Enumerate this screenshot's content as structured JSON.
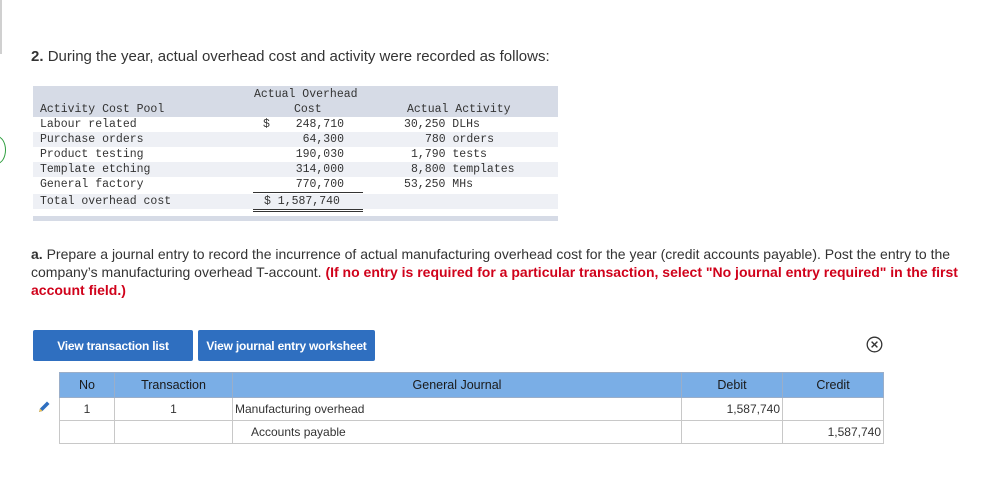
{
  "question": {
    "number": "2.",
    "text": "During the year, actual overhead cost and activity were recorded as follows:"
  },
  "overhead_table": {
    "header_pool": "Activity Cost Pool",
    "header_cost_line1": "Actual Overhead",
    "header_cost_line2": "Cost",
    "header_activity": "Actual Activity",
    "currency_symbol": "$",
    "rows": [
      {
        "pool": "Labour related",
        "cost": "248,710",
        "activity": "30,250 DLHs"
      },
      {
        "pool": "Purchase orders",
        "cost": "64,300",
        "activity": "780 orders"
      },
      {
        "pool": "Product testing",
        "cost": "190,030",
        "activity": "1,790 tests"
      },
      {
        "pool": "Template etching",
        "cost": "314,000",
        "activity": "8,800 templates"
      },
      {
        "pool": "General factory",
        "cost": "770,700",
        "activity": "53,250 MHs"
      }
    ],
    "total_label": "Total overhead cost",
    "total_value": "$ 1,587,740"
  },
  "instruction": {
    "part": "a.",
    "text": "Prepare a journal entry to record the incurrence of actual manufacturing overhead cost for the year (credit accounts payable). Post the entry to the company’s manufacturing overhead T-account.",
    "note": "(If no entry is required for a particular transaction, select \"No journal entry required\" in the first account field.)"
  },
  "buttons": {
    "transaction_list": "View transaction list",
    "journal_worksheet": "View journal entry worksheet"
  },
  "icons": {
    "close": "close-circle-icon",
    "edit": "pencil-icon"
  },
  "journal": {
    "headers": {
      "no": "No",
      "transaction": "Transaction",
      "general_journal": "General Journal",
      "debit": "Debit",
      "credit": "Credit"
    },
    "rows": [
      {
        "no": "1",
        "transaction": "1",
        "account": "Manufacturing overhead",
        "debit": "1,587,740",
        "credit": ""
      },
      {
        "no": "",
        "transaction": "",
        "account": "Accounts payable",
        "debit": "",
        "credit": "1,587,740"
      }
    ]
  },
  "colors": {
    "button": "#2f6fc0",
    "table_header": "#7aaee6",
    "note_red": "#d0021b",
    "data_header": "#d6dbe6"
  }
}
